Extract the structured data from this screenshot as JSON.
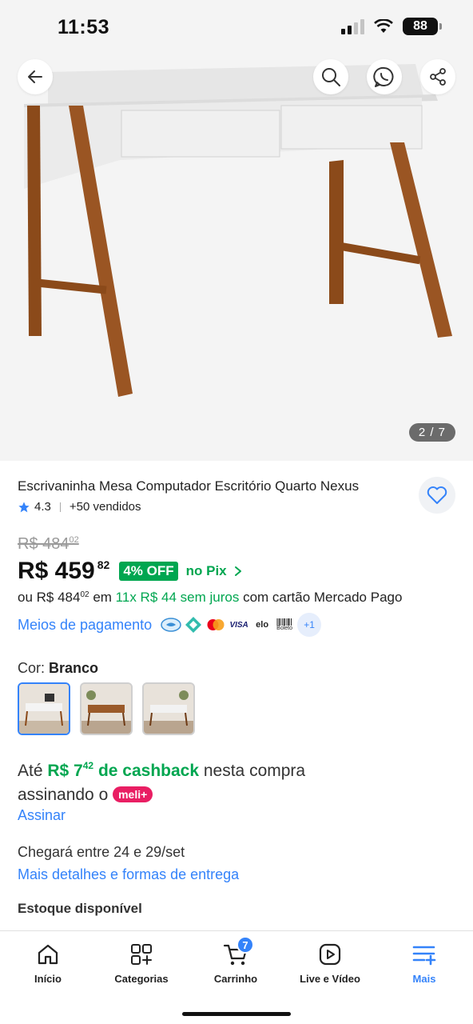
{
  "status_bar": {
    "time": "11:53",
    "battery": "88"
  },
  "gallery": {
    "counter": "2 / 7"
  },
  "icons": {
    "back": "arrow-left-icon",
    "search": "search-icon",
    "whatsapp": "whatsapp-icon",
    "share": "share-icon",
    "favorite": "heart-icon"
  },
  "product": {
    "title": "Escrivaninha Mesa Computador Escritório Quarto Nexus",
    "rating": "4.3",
    "sold": "+50 vendidos",
    "old_price": "R$ 484",
    "old_price_cents": "02",
    "price": "R$ 459",
    "price_cents": "82",
    "discount": "4% OFF",
    "pix": "no Pix",
    "installments_prefix": "ou R$ 484",
    "installments_cents": "02",
    "installments_mid": "em",
    "installments_green": "11x R$ 44 sem juros",
    "installments_suffix": "com cartão Mercado Pago",
    "payment_link": "Meios de pagamento",
    "payment_methods": [
      "Mercado Pago",
      "Pix",
      "Mastercard",
      "VISA",
      "elo",
      "Boleto"
    ],
    "payment_more": "+1",
    "color_label": "Cor:",
    "color_value": "Branco"
  },
  "cashback": {
    "prefix": "Até",
    "amount": "R$ 7",
    "amount_cents": "42",
    "green_suffix": "de cashback",
    "suffix": "nesta compra",
    "line2": "assinando o",
    "badge": "meli+",
    "link": "Assinar"
  },
  "delivery": {
    "text": "Chegará entre 24 e 29/set",
    "link": "Mais detalhes e formas de entrega"
  },
  "stock": "Estoque disponível",
  "nav": {
    "items": [
      {
        "label": "Início",
        "icon": "home-icon"
      },
      {
        "label": "Categorias",
        "icon": "categories-icon"
      },
      {
        "label": "Carrinho",
        "icon": "cart-icon",
        "badge": "7"
      },
      {
        "label": "Live e Vídeo",
        "icon": "play-icon"
      },
      {
        "label": "Mais",
        "icon": "menu-plus-icon",
        "active": true
      }
    ]
  },
  "colors": {
    "accent": "#3483fa",
    "green": "#00a650",
    "meli": "#e91e63"
  }
}
